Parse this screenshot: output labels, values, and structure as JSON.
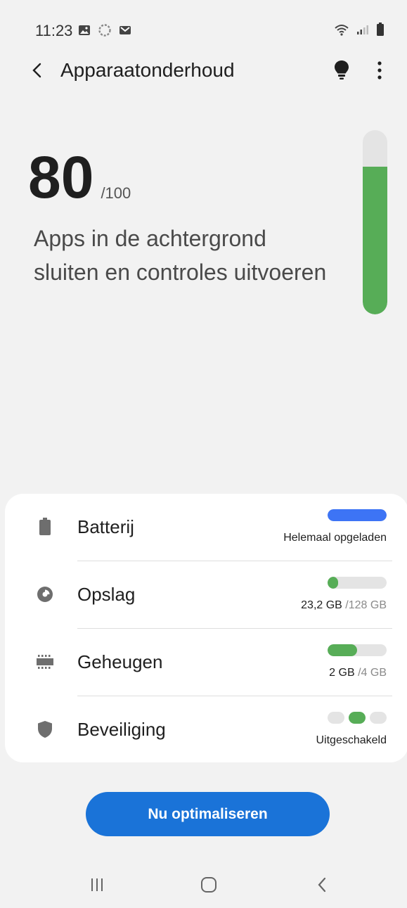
{
  "status_bar": {
    "time": "11:23",
    "left_icons": [
      "gallery-icon",
      "sync-icon",
      "mail-icon"
    ],
    "right_icons": [
      "wifi-icon",
      "signal-icon",
      "battery-icon"
    ]
  },
  "appbar": {
    "title": "Apparaatonderhoud",
    "back_icon": "back-arrow-icon",
    "actions": [
      "lightbulb-icon",
      "more-options-icon"
    ]
  },
  "score": {
    "value": "80",
    "max": "/100",
    "fraction": 0.8,
    "description": "Apps in de achtergrond sluiten en controles uitvoeren",
    "bar_color": "#57ad57",
    "track_color": "#e4e4e4"
  },
  "items": [
    {
      "label": "Batterij",
      "icon": "battery-icon",
      "status": "Helemaal opgeladen",
      "status_muted": "",
      "bar_fraction": 1.0,
      "bar_color": "#3d74f5"
    },
    {
      "label": "Opslag",
      "icon": "storage-pie-icon",
      "status": "23,2 GB",
      "status_muted": "/128 GB",
      "bar_fraction": 0.18,
      "bar_color": "#57ad57"
    },
    {
      "label": "Geheugen",
      "icon": "memory-chip-icon",
      "status": "2 GB",
      "status_muted": "/4 GB",
      "bar_fraction": 0.5,
      "bar_color": "#57ad57"
    },
    {
      "label": "Beveiliging",
      "icon": "shield-icon",
      "status": "Uitgeschakeld",
      "status_muted": "",
      "level": 2,
      "level_max": 3,
      "bar_color": "#57ad57"
    }
  ],
  "optimize_button": {
    "label": "Nu optimaliseren",
    "color": "#1a73d8"
  },
  "navbar": {
    "buttons": [
      "recent-apps-icon",
      "home-icon",
      "back-icon"
    ]
  }
}
